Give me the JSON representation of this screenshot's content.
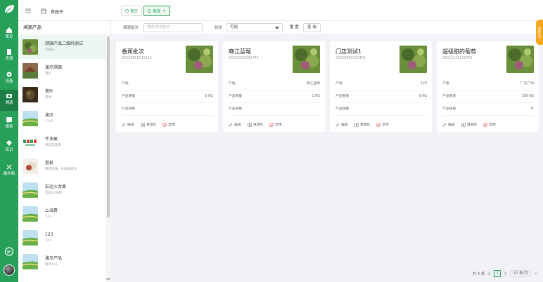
{
  "nav": {
    "items": [
      {
        "label": "首页",
        "icon": "home-icon"
      },
      {
        "label": "农场",
        "icon": "farm-icon"
      },
      {
        "label": "设备",
        "icon": "device-icon"
      },
      {
        "label": "溯源",
        "icon": "trace-icon"
      },
      {
        "label": "报表",
        "icon": "report-icon"
      },
      {
        "label": "农识",
        "icon": "knowledge-icon"
      },
      {
        "label": "碳中和",
        "icon": "carbon-icon"
      }
    ],
    "active_index": 3
  },
  "header": {
    "shop_name": "茶园子",
    "tabs": [
      {
        "label": "首页"
      },
      {
        "label": "溯源",
        "closable": "×"
      }
    ]
  },
  "panel": {
    "title": "溯源产品",
    "items": [
      {
        "name": "溯源产品二维码测试",
        "sub": "云都天",
        "thumb": "grape"
      },
      {
        "name": "演示溯源",
        "sub": "演示",
        "thumb": "house"
      },
      {
        "name": "茶叶",
        "sub": "茶叶",
        "thumb": "dark"
      },
      {
        "name": "演示",
        "sub": "1111",
        "thumb": "field"
      },
      {
        "name": "牛油果",
        "sub": "好吃又美味",
        "thumb": "logo"
      },
      {
        "name": "荔枝",
        "sub": "果肉饱满，价值很高有",
        "thumb": "lychee"
      },
      {
        "name": "宏运火龙果",
        "sub": "宏运火龙果1",
        "thumb": "field"
      },
      {
        "name": "上海青",
        "sub": "123",
        "thumb": "field"
      },
      {
        "name": "123",
        "sub": "123",
        "thumb": "field"
      },
      {
        "name": "演示产品",
        "sub": "演示111",
        "thumb": "field"
      }
    ]
  },
  "filter": {
    "batch_label": "溯源批次",
    "batch_placeholder": "搜索溯源批次",
    "status_label": "状态",
    "status_value": "可用",
    "reset_label": "重 置",
    "query_label": "查 询"
  },
  "cards": [
    {
      "title": "香蕉批次",
      "code": "20220615141019",
      "origin_label": "产地",
      "origin": "",
      "weight_label": "产品重量",
      "weight": "0 KG",
      "spec_label": "产品规格",
      "spec": ""
    },
    {
      "title": "麻江蓝莓",
      "code": "20220522091743",
      "origin_label": "产地",
      "origin": "麻江蓝莓",
      "weight_label": "产品重量",
      "weight": "1 KG",
      "spec_label": "产品规格",
      "spec": ""
    },
    {
      "title": "门店测试1",
      "code": "20220309111450",
      "origin_label": "产地",
      "origin": "123",
      "weight_label": "产品重量",
      "weight": "0 KG",
      "spec_label": "产品规格",
      "spec": ""
    },
    {
      "title": "超级甜的葡萄",
      "code": "20211125103701",
      "origin_label": "产地",
      "origin": "广东广州",
      "weight_label": "产品重量",
      "weight": "100 KG",
      "spec_label": "产品规格",
      "spec": "斤"
    }
  ],
  "card_actions": {
    "edit": "编辑",
    "trace_code": "溯源码",
    "disable": "禁用"
  },
  "pager": {
    "total": "共 4 条",
    "page": "1",
    "size": "20 条/页"
  },
  "float_tab": "种植任务",
  "colors": {
    "brand": "#27a05a",
    "accent": "#f5a623"
  }
}
